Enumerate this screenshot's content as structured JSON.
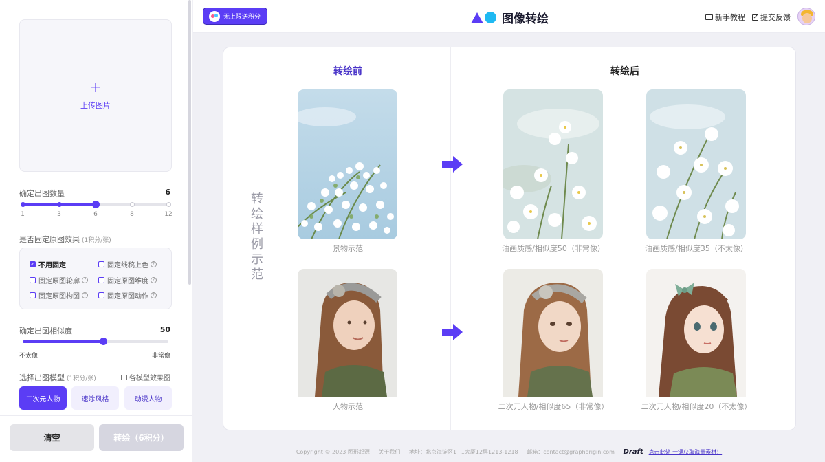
{
  "header": {
    "points_button": "无上限送积分",
    "app_title": "图像转绘",
    "tutorial_link": "新手教程",
    "feedback_link": "提交反馈",
    "colors": {
      "brand": "#5b3df5",
      "logo_circle": "#1fb9f2"
    }
  },
  "sidebar": {
    "upload": {
      "plus_icon": "+",
      "label": "上传图片"
    },
    "count": {
      "title": "确定出图数量",
      "value": "6",
      "ticks": [
        "1",
        "3",
        "6",
        "8",
        "12"
      ],
      "selected_index": 2
    },
    "fix": {
      "title": "是否固定原图效果",
      "cost": "(1积分/张)",
      "options": [
        {
          "label": "不用固定",
          "checked": true,
          "help": false
        },
        {
          "label": "固定线稿上色",
          "checked": false,
          "help": true
        },
        {
          "label": "固定原图轮廓",
          "checked": false,
          "help": true
        },
        {
          "label": "固定原图维度",
          "checked": false,
          "help": true
        },
        {
          "label": "固定原图构图",
          "checked": false,
          "help": true
        },
        {
          "label": "固定原图动作",
          "checked": false,
          "help": true
        }
      ]
    },
    "similarity": {
      "title": "确定出图相似度",
      "value": "50",
      "level_percent": 55,
      "left_label": "不太像",
      "right_label": "非常像"
    },
    "model": {
      "title": "选择出图模型",
      "cost": "(1积分/张)",
      "effect_link": "各模型效果图",
      "buttons": [
        "二次元人物",
        "速涂风格",
        "动漫人物"
      ],
      "active_index": 0
    },
    "footer": {
      "clear_button": "清空",
      "convert_button": "转绘（6积分）"
    }
  },
  "main": {
    "before_title": "转绘前",
    "after_title": "转绘后",
    "side_label": "转绘样例示范",
    "captions": {
      "scene_example": "景物示范",
      "scene_result_1": "油画质感/相似度50（非常像）",
      "scene_result_2": "油画质感/相似度35（不太像）",
      "person_example": "人物示范",
      "person_result_1": "二次元人物/相似度65（非常像）",
      "person_result_2": "二次元人物/相似度20（不太像）"
    }
  },
  "footer": {
    "copyright": "Copyright © 2023 图形起源",
    "about": "关于我们",
    "address": "地址：北京海淀区1+1大厦12层1213-1218",
    "email": "邮箱：contact@graphorigin.com",
    "draft_logo": "Draft",
    "promo": "点击此处 一键获取海量素材！"
  }
}
